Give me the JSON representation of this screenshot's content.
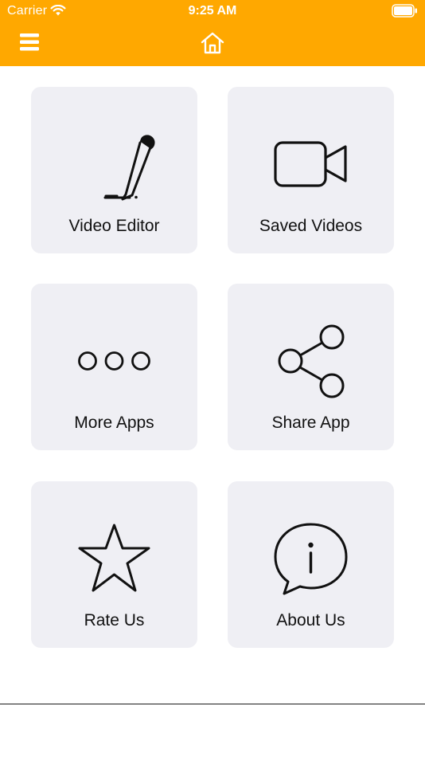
{
  "status_bar": {
    "carrier": "Carrier",
    "time": "9:25 AM"
  },
  "navbar": {
    "menu_icon": "hamburger-menu-icon",
    "home_icon": "home-icon"
  },
  "colors": {
    "accent": "#FFA800",
    "tile_background": "#EFEFF4",
    "text": "#111111"
  },
  "tiles": [
    {
      "label": "Video Editor",
      "icon": "pencil-icon"
    },
    {
      "label": "Saved Videos",
      "icon": "video-camera-icon"
    },
    {
      "label": "More Apps",
      "icon": "more-icon"
    },
    {
      "label": "Share App",
      "icon": "share-icon"
    },
    {
      "label": "Rate Us",
      "icon": "star-icon"
    },
    {
      "label": "About Us",
      "icon": "info-icon"
    }
  ]
}
